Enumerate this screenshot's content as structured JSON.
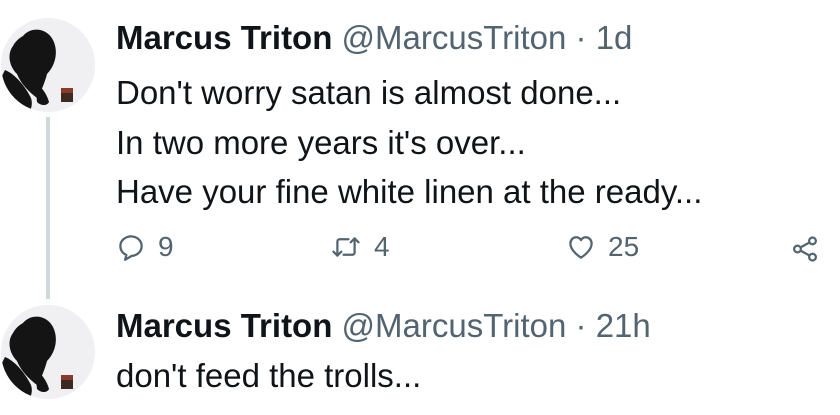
{
  "tweets": [
    {
      "name": "Marcus Triton",
      "handle": "@MarcusTriton",
      "separator": "·",
      "time": "1d",
      "lines": [
        "Don't worry satan is almost done...",
        "In two more years it's over...",
        "Have your fine white linen at the ready..."
      ],
      "replies": "9",
      "retweets": "4",
      "likes": "25"
    },
    {
      "name": "Marcus Triton",
      "handle": "@MarcusTriton",
      "separator": "·",
      "time": "21h",
      "lines": [
        "don't feed the trolls..."
      ]
    }
  ],
  "icons": {
    "reply": "reply-icon",
    "retweet": "retweet-icon",
    "like": "heart-icon",
    "share": "share-icon"
  },
  "colors": {
    "text": "#0f1419",
    "secondary": "#536471",
    "thread_line": "#cfd9de"
  }
}
